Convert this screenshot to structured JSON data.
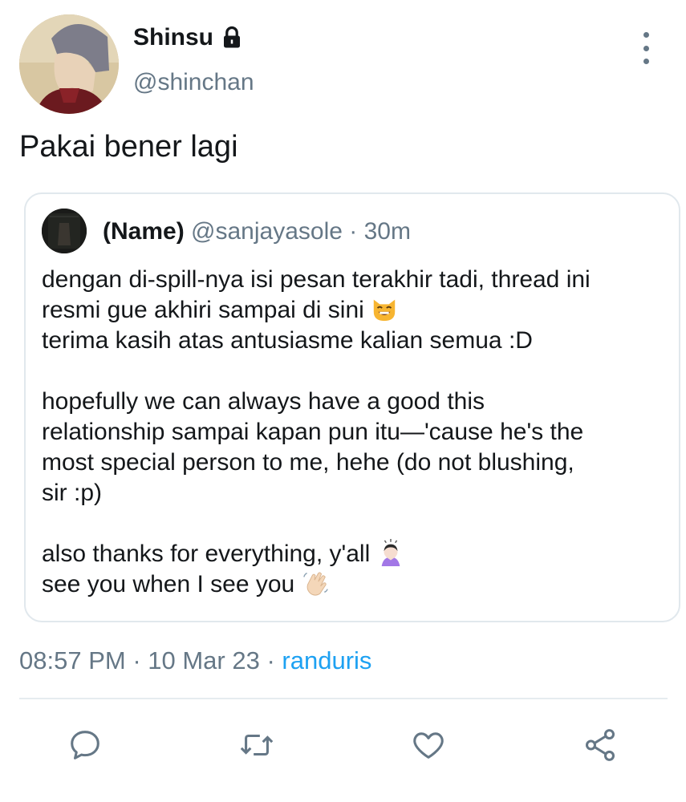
{
  "tweet": {
    "author": {
      "display_name": "Shinsu",
      "handle": "@shinchan",
      "protected_icon": "lock-icon"
    },
    "more_icon": "more-vertical-icon",
    "text": "Pakai bener lagi"
  },
  "quoted_tweet": {
    "name": "(Name)",
    "handle": "@sanjayasole",
    "separator": " · ",
    "time_ago": "30m",
    "lines": [
      "dengan di-spill-nya isi pesan terakhir tadi, thread ini",
      "resmi gue akhiri sampai di sini",
      "terima kasih atas antusiasme kalian semua :D",
      "",
      "hopefully we can always have a good this",
      "relationship sampai kapan pun itu—'cause he's the",
      "most special person to me, hehe (do not blushing,",
      "sir :p)",
      "",
      "also thanks for everything, y'all",
      "see you when I see you"
    ],
    "emojis": {
      "line2": "smiling-cat-emoji",
      "line10": "person-bowing-emoji",
      "line11": "waving-hand-emoji"
    }
  },
  "footer": {
    "time": "08:57 PM",
    "dot1": " · ",
    "date": "10 Mar 23",
    "dot2": " · ",
    "source": "randuris"
  },
  "actions": [
    "reply-icon",
    "retweet-icon",
    "like-icon",
    "share-icon"
  ],
  "colors": {
    "text": "#14171a",
    "muted": "#657786",
    "link": "#1da1f2",
    "border": "#e1e8ed"
  }
}
